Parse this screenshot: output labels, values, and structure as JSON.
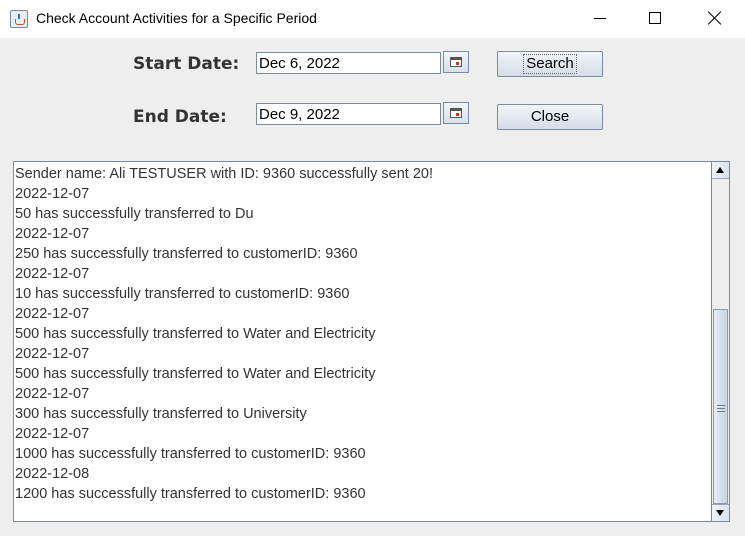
{
  "window": {
    "title": "Check Account Activities for a Specific Period"
  },
  "form": {
    "start_label": "Start Date:",
    "start_value": "Dec 6, 2022",
    "end_label": "End Date:",
    "end_value": "Dec 9, 2022",
    "search_label": "Search",
    "close_label": "Close"
  },
  "activity_log": {
    "lines": [
      "Sender name: Ali TESTUSER with ID: 9360 successfully sent 20!",
      "2022-12-07",
      "50 has successfully transferred to Du",
      "2022-12-07",
      "250 has successfully transferred to customerID: 9360",
      "2022-12-07",
      "10 has successfully transferred to customerID: 9360",
      "2022-12-07",
      "500 has successfully transferred to Water and Electricity",
      "2022-12-07",
      "500 has successfully transferred to Water and Electricity",
      "2022-12-07",
      "300 has successfully transferred to University",
      "2022-12-07",
      "1000 has successfully transferred to customerID: 9360",
      "2022-12-08",
      "1200 has successfully transferred to customerID: 9360"
    ],
    "scroll_position_fraction": 1.0,
    "visible_fraction": 0.6
  },
  "icons": {
    "app": "java-cup-icon",
    "minimize": "minimize-icon",
    "maximize": "maximize-icon",
    "close": "close-icon",
    "calendar": "calendar-icon",
    "scroll_up": "arrow-up-icon",
    "scroll_down": "arrow-down-icon"
  }
}
